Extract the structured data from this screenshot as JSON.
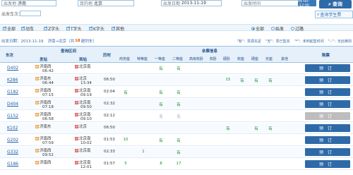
{
  "search": {
    "from_label": "出发地",
    "from_value": "济南",
    "to_label": "目的地",
    "to_value": "北京",
    "date_label": "出发日期",
    "date_value": "2013-11-19",
    "time_label": "出发时间",
    "time_value": "06:00--12:00",
    "train_label": "出发车次：",
    "query_button": "查询",
    "student_button": "查询学生票"
  },
  "filters": {
    "types": [
      {
        "label": "全部",
        "checked": true
      },
      {
        "label": "动车",
        "checked": true
      },
      {
        "label": "Z字头",
        "checked": true
      },
      {
        "label": "T字头",
        "checked": true
      },
      {
        "label": "K字头",
        "checked": true
      },
      {
        "label": "其他",
        "checked": true
      }
    ],
    "station_opts": [
      {
        "label": "全部",
        "on": true
      },
      {
        "label": "始发",
        "on": false
      },
      {
        "label": "过路",
        "on": false
      }
    ]
  },
  "info": {
    "prefix": "出发日期：2013-11-19",
    "route": "济南→北京（共",
    "count": "18",
    "suffix": "趟列车）"
  },
  "legend": [
    "\"有\"：票源充足",
    "\"无\"：票已售完",
    "\"*\"：未到起售时间",
    "\"--\"：无此席别"
  ],
  "columns": {
    "train": "车次",
    "interval": "查询区间",
    "from": "发站",
    "to": "到站",
    "duration": "历时",
    "seat_group": "余票信息",
    "seats": [
      "商务座",
      "特等座",
      "一等座",
      "二等座",
      "高级软卧",
      "软卧",
      "硬卧",
      "软座",
      "硬座",
      "无座",
      "其他"
    ],
    "book": "购票"
  },
  "rows": [
    {
      "train": "D402",
      "from": "济南西",
      "from_time": "06:42",
      "to": "北京南",
      "to_time": "",
      "duration": "",
      "seats": [
        "",
        "",
        "有",
        "有",
        "",
        "",
        "",
        "",
        "",
        "",
        ""
      ],
      "book": "预订",
      "avail": true
    },
    {
      "train": "K286",
      "from": "济南东",
      "from_time": "06:44",
      "to": "北京",
      "to_time": "13:34",
      "duration": "06:50",
      "seats": [
        "",
        "",
        "",
        "",
        "",
        "",
        "15",
        "有",
        "有",
        "有",
        ""
      ],
      "book": "预订",
      "avail": true
    },
    {
      "train": "G182",
      "from": "济南西",
      "from_time": "07:15",
      "to": "北京南",
      "to_time": "09:19",
      "duration": "02:04",
      "seats": [
        "有",
        "",
        "有",
        "有",
        "",
        "",
        "",
        "",
        "",
        "",
        ""
      ],
      "book": "预订",
      "avail": true
    },
    {
      "train": "D404",
      "from": "济南西",
      "from_time": "07:18",
      "to": "北京南",
      "to_time": "09:50",
      "duration": "02:32",
      "seats": [
        "",
        "",
        "有",
        "有",
        "",
        "",
        "",
        "",
        "",
        "",
        ""
      ],
      "book": "预订",
      "avail": true
    },
    {
      "train": "G152",
      "from": "济南西",
      "from_time": "06:58",
      "to": "北京南",
      "to_time": "09:10",
      "duration": "02:12",
      "seats": [
        "",
        "",
        "无",
        "无",
        "",
        "",
        "",
        "",
        "",
        "",
        ""
      ],
      "book": "预订",
      "avail": false
    },
    {
      "train": "K102",
      "from": "济南东",
      "from_time": "",
      "to": "北京",
      "to_time": "",
      "duration": "06:50",
      "seats": [
        "",
        "",
        "",
        "",
        "",
        "",
        "有",
        "",
        "有",
        "有",
        ""
      ],
      "book": "预订",
      "avail": true
    },
    {
      "train": "G202",
      "from": "济南西",
      "from_time": "07:59",
      "to": "北京南",
      "to_time": "10:02",
      "duration": "01:53",
      "seats": [
        "10",
        "",
        "有",
        "有",
        "",
        "",
        "",
        "",
        "",
        "",
        ""
      ],
      "book": "预订",
      "avail": true
    },
    {
      "train": "G332",
      "from": "济南西",
      "from_time": "09:52",
      "to": "北京南",
      "to_time": "",
      "duration": "02:33",
      "seats": [
        "",
        "1",
        "",
        "有",
        "",
        "",
        "",
        "",
        "",
        "",
        ""
      ],
      "book": "预订",
      "avail": true
    },
    {
      "train": "G186",
      "from": "济南西",
      "from_time": "",
      "to": "北京南",
      "to_time": "12:01",
      "duration": "01:57",
      "seats": [
        "5",
        "",
        "8",
        "17",
        "",
        "",
        "",
        "",
        "",
        "",
        ""
      ],
      "book": "预订",
      "avail": true
    }
  ]
}
